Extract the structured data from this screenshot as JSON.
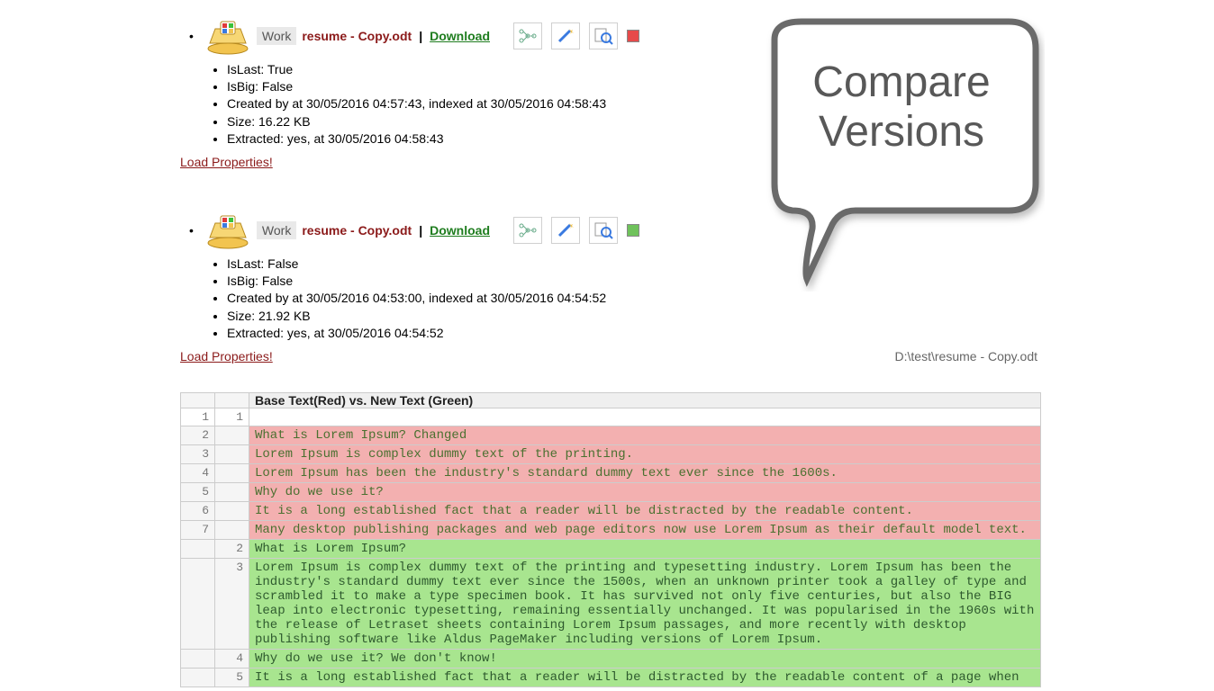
{
  "bubble": {
    "line1": "Compare",
    "line2": "Versions"
  },
  "path": "D:\\test\\resume - Copy.odt",
  "load_properties": "Load Properties!",
  "work_label": "Work",
  "download_label": "Download",
  "version1": {
    "filename": "resume - Copy.odt",
    "islast": "IsLast: True",
    "isbig": "IsBig: False",
    "created": "Created by            at 30/05/2016 04:57:43, indexed at 30/05/2016 04:58:43",
    "size": "Size: 16.22 KB",
    "extracted": "Extracted: yes, at 30/05/2016 04:58:43",
    "status": "red"
  },
  "version2": {
    "filename": "resume - Copy.odt",
    "islast": "IsLast: False",
    "isbig": "IsBig: False",
    "created": "Created by            at 30/05/2016 04:53:00, indexed at 30/05/2016 04:54:52",
    "size": "Size: 21.92 KB",
    "extracted": "Extracted: yes, at 30/05/2016 04:54:52",
    "status": "green"
  },
  "diff": {
    "title": "Base Text(Red) vs. New Text (Green)",
    "red": [
      {
        "col1": "2",
        "col2": "",
        "text": "What is Lorem Ipsum? Changed"
      },
      {
        "col1": "3",
        "col2": "",
        "text": "Lorem Ipsum is complex dummy text of the printing."
      },
      {
        "col1": "4",
        "col2": "",
        "text": "Lorem Ipsum has been the industry's standard dummy text ever since the 1600s."
      },
      {
        "col1": "5",
        "col2": "",
        "text": "Why do we use it?"
      },
      {
        "col1": "6",
        "col2": "",
        "text": "It is a long established fact that a reader will be distracted by the readable content."
      },
      {
        "col1": "7",
        "col2": "",
        "text": "Many desktop publishing packages and web page editors now use Lorem Ipsum as their default model text."
      }
    ],
    "green": [
      {
        "col1": "",
        "col2": "2",
        "text": "What is Lorem Ipsum?"
      },
      {
        "col1": "",
        "col2": "3",
        "text": "Lorem Ipsum is complex dummy text of the printing and typesetting industry. Lorem Ipsum has been the industry's standard dummy text ever since the 1500s, when an unknown printer took a galley of type and scrambled it to make a type specimen book. It has survived not only five centuries, but also the BIG leap into electronic typesetting, remaining essentially unchanged. It was popularised in the 1960s with the release of Letraset sheets containing Lorem Ipsum passages, and more recently with desktop publishing software like Aldus PageMaker including versions of Lorem Ipsum."
      },
      {
        "col1": "",
        "col2": "4",
        "text": "Why do we use it? We don't know!"
      },
      {
        "col1": "",
        "col2": "5",
        "text": "It is a long established fact that a reader will be distracted by the readable content of a page when"
      }
    ]
  }
}
